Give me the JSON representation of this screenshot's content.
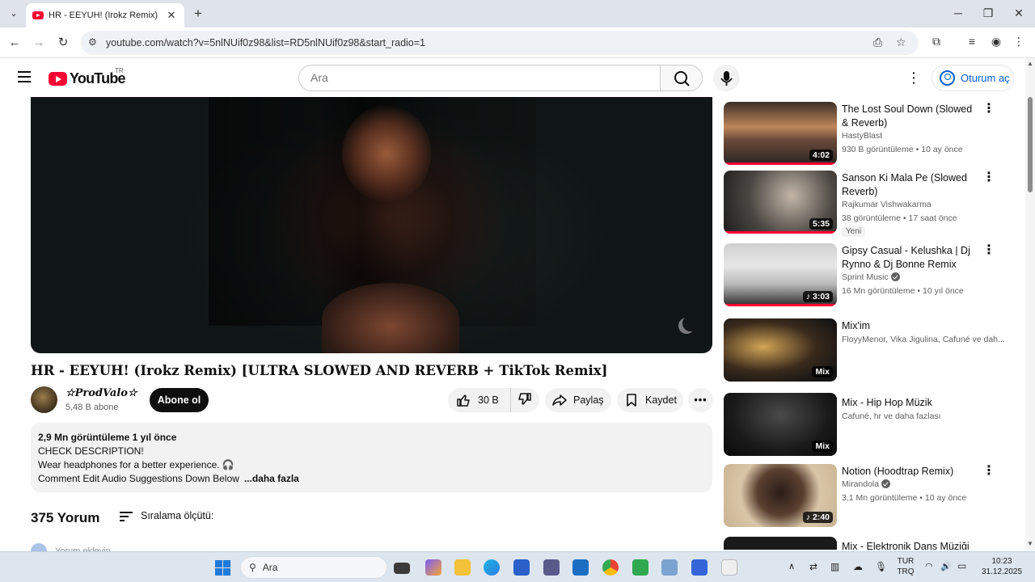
{
  "browser": {
    "tab_title": "HR - EEYUH! (Irokz Remix) [U",
    "url": "youtube.com/watch?v=5nlNUif0z98&list=RD5nlNUif0z98&start_radio=1",
    "new_tab": "+",
    "close_tab": "✕"
  },
  "header": {
    "logo_text": "YouTube",
    "region": "TR",
    "search_placeholder": "Ara",
    "signin_label": "Oturum aç"
  },
  "video": {
    "title": "HR - EEYUH! (Irokz Remix) [ULTRA SLOWED AND REVERB + TikTok Remix]",
    "channel_name": "☆ProdValo☆",
    "subscribers": "5,48 B abone",
    "subscribe_label": "Abone ol",
    "likes": "30 B",
    "share_label": "Paylaş",
    "save_label": "Kaydet"
  },
  "description": {
    "meta": "2,9 Mn görüntüleme  1 yıl önce",
    "lines": [
      "CHECK DESCRIPTION!",
      "Wear headphones for a better experience. 🎧",
      "Comment Edit Audio Suggestions Down Below"
    ],
    "more_label": "...daha fazla"
  },
  "comments": {
    "count_label": "375 Yorum",
    "sort_label": "Sıralama ölçütü:",
    "add_placeholder": "Yorum ekleyin..."
  },
  "sidebar": {
    "items": [
      {
        "title": "The Lost Soul Down (Slowed & Reverb)",
        "channel": "HastyBlast",
        "stats": "930 B görüntüleme • 10 ay önce",
        "duration": "4:02",
        "verified": false,
        "badge": "",
        "mix": false
      },
      {
        "title": "Sanson Ki Mala Pe (Slowed Reverb)",
        "channel": "Rajkumar Vishwakarma",
        "stats": "38 görüntüleme • 17 saat önce",
        "duration": "5:35",
        "verified": false,
        "badge": "Yeni",
        "mix": false
      },
      {
        "title": "Gipsy Casual - Kelushka | Dj Rynno & Dj Bonne Remix",
        "channel": "Sprint Music",
        "stats": "16 Mn görüntüleme • 10 yıl önce",
        "duration": "♪ 3:03",
        "verified": true,
        "badge": "",
        "mix": false
      },
      {
        "title": "Mix'im",
        "channel": "FloyyMenor, Vika Jigulina, Cafuné ve dah...",
        "stats": "",
        "duration": "Mix",
        "verified": false,
        "badge": "",
        "mix": true
      },
      {
        "title": "Mix - Hip Hop Müzik",
        "channel": "Cafuné, hr ve daha fazlası",
        "stats": "",
        "duration": "Mix",
        "verified": false,
        "badge": "",
        "mix": true
      },
      {
        "title": "Notion (Hoodtrap Remix)",
        "channel": "Mirandola",
        "stats": "3,1 Mn görüntüleme • 10 ay önce",
        "duration": "♪ 2:40",
        "verified": true,
        "badge": "",
        "mix": false
      },
      {
        "title": "Mix - Elektronik Dans Müziği",
        "channel": "",
        "stats": "",
        "duration": "",
        "verified": false,
        "badge": "",
        "mix": true
      }
    ]
  },
  "taskbar": {
    "search_label": "Ara",
    "lang_top": "TUR",
    "lang_bottom": "TRQ",
    "time": "10:23",
    "date": "31.12.2025"
  },
  "icons": {
    "back": "back-arrow-icon",
    "forward": "forward-arrow-icon",
    "reload": "reload-icon",
    "like": "thumbs-up-icon",
    "dislike": "thumbs-down-icon",
    "share": "share-arrow-icon",
    "save": "bookmark-icon"
  },
  "colors": {
    "brand_red": "#ff0033",
    "link_blue": "#065fd4",
    "pill_bg": "#f2f2f2"
  }
}
